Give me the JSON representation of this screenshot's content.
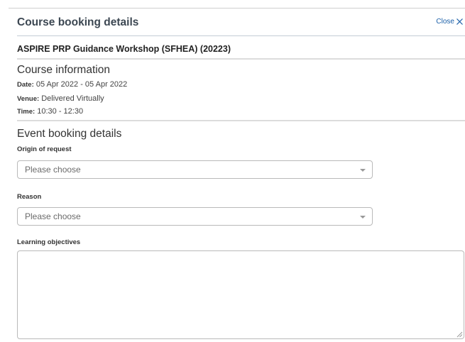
{
  "modal": {
    "title": "Course booking details",
    "close_label": "Close"
  },
  "course": {
    "name": "ASPIRE PRP Guidance Workshop (SFHEA) (20223)"
  },
  "course_information": {
    "heading": "Course information",
    "date_label": "Date:",
    "date_value": "05 Apr 2022 - 05 Apr 2022",
    "venue_label": "Venue:",
    "venue_value": "Delivered Virtually",
    "time_label": "Time:",
    "time_value": "10:30 - 12:30"
  },
  "event_booking": {
    "heading": "Event booking details",
    "origin_label": "Origin of request",
    "origin_value": "Please choose",
    "reason_label": "Reason",
    "reason_value": "Please choose",
    "objectives_label": "Learning objectives",
    "objectives_value": ""
  },
  "icons": {
    "close": "close-icon",
    "dropdown": "chevron-down-icon"
  },
  "colors": {
    "link": "#1a5fa8",
    "title": "#3c4752"
  }
}
